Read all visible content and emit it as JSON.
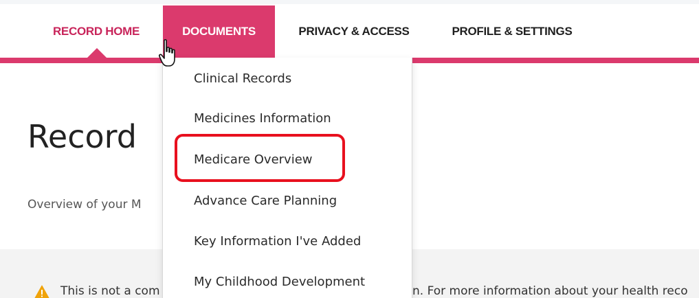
{
  "nav": {
    "items": [
      {
        "label": "RECORD HOME"
      },
      {
        "label": "DOCUMENTS"
      },
      {
        "label": "PRIVACY & ACCESS"
      },
      {
        "label": "PROFILE & SETTINGS"
      }
    ],
    "active_item": "DOCUMENTS",
    "accent_color": "#db3a6d"
  },
  "dropdown": {
    "items": [
      {
        "label": "Clinical Records"
      },
      {
        "label": "Medicines Information"
      },
      {
        "label": "Medicare Overview"
      },
      {
        "label": "Advance Care Planning"
      },
      {
        "label": "Key Information I've Added"
      },
      {
        "label": "My Childhood Development"
      }
    ],
    "highlighted_item": "Medicare Overview",
    "highlight_color": "#e8101e"
  },
  "main": {
    "title": "Record",
    "subtitle": "Overview of your M",
    "notice": {
      "text_left": "This is not a com",
      "text_right": "n. For more information about your health reco",
      "icon": "warning-icon"
    }
  },
  "cursor": {
    "icon": "hand-pointer-icon"
  }
}
